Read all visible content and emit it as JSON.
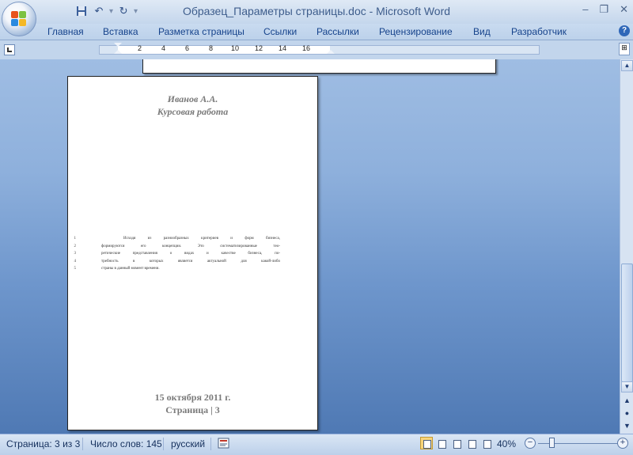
{
  "window": {
    "title": "Образец_Параметры страницы.doc - Microsoft Word",
    "minimize": "–",
    "restore": "❐",
    "close": "✕"
  },
  "quick_access": {
    "save_icon": "save-icon",
    "undo_icon": "undo-icon",
    "redo_icon": "redo-icon",
    "customize_icon": "customize-icon"
  },
  "ribbon": {
    "tabs": [
      "Главная",
      "Вставка",
      "Разметка страницы",
      "Ссылки",
      "Рассылки",
      "Рецензирование",
      "Вид",
      "Разработчик"
    ],
    "help": "?"
  },
  "ruler": {
    "numbers": [
      "2",
      "4",
      "6",
      "8",
      "10",
      "12",
      "14",
      "16"
    ]
  },
  "document": {
    "header_line1": "Иванов А.А.",
    "header_line2": "Курсовая работа",
    "lines": [
      {
        "num": "1",
        "text": "Исходя из разнообразных критериев и форм бизнеса,"
      },
      {
        "num": "2",
        "text": "формируются его концепции. Это систематизированные тео-"
      },
      {
        "num": "3",
        "text": "ретические представления о видах и качестве бизнеса, по-"
      },
      {
        "num": "4",
        "text": "требность в которых является актуальной для какой-либо"
      },
      {
        "num": "5",
        "text": "страны в данный момент времени."
      }
    ],
    "footer_date": "15 октября 2011 г.",
    "footer_page": "Страница | 3"
  },
  "statusbar": {
    "page": "Страница: 3 из 3",
    "words": "Число слов: 145",
    "language": "русский",
    "zoom": "40%",
    "zoom_level": 0.4
  },
  "colors": {
    "workspace_top": "#9fbde3",
    "workspace_bottom": "#4f79b4",
    "tab_text": "#15428b"
  }
}
